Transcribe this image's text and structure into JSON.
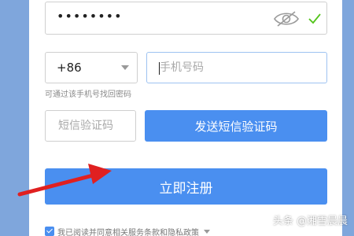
{
  "password": {
    "value": "••••••••",
    "visibility_icon": "eye-icon",
    "valid_icon": "check-icon"
  },
  "country": {
    "code": "+86"
  },
  "phone": {
    "placeholder": "手机号码",
    "hint": "可通过该手机号找回密码"
  },
  "sms": {
    "placeholder": "短信验证码",
    "send_label": "发送短信验证码"
  },
  "register": {
    "label": "立即注册"
  },
  "agreement": {
    "text": "我已阅读并同意相关服务条款和隐私政策",
    "checked": true
  },
  "watermark": {
    "text": "头条 @湘雪晨晨"
  },
  "colors": {
    "accent": "#4a8ff0",
    "background": "#7fa6dc",
    "arrow": "#e02020",
    "check": "#52c41a"
  }
}
